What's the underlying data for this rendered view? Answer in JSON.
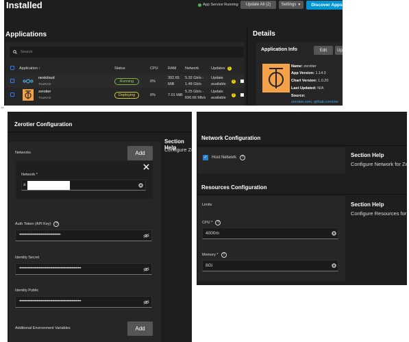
{
  "installed": {
    "title": "Installed",
    "status_text": "App Service Running",
    "update_all_label": "Update All (2)",
    "settings_label": "Settings",
    "discover_label": "Discover Apps",
    "applications_heading": "Applications",
    "details_heading": "Details",
    "search_placeholder": "Search",
    "columns": [
      "Application",
      "Status",
      "CPU",
      "RAM",
      "Network",
      "Updates"
    ],
    "rows": [
      {
        "name": "nextcloud",
        "source": "TrueNAS",
        "status": "Running",
        "cpu": "0%",
        "ram_a": "392.65",
        "ram_b": "MiB",
        "net_a": "5.32 Gb/s -",
        "net_b": "1.48 Gb/s",
        "upd_a": "Update",
        "upd_b": "available"
      },
      {
        "name": "zerotier",
        "source": "TrueNAS",
        "status": "Deploying",
        "cpu": "0%",
        "ram_a": "7.01 MiB",
        "ram_b": "",
        "net_a": "5.25 Gb/s -",
        "net_b": "696.66 Mb/s",
        "upd_a": "Update",
        "upd_b": "available"
      }
    ],
    "info": {
      "title": "Application Info",
      "edit_label": "Edit",
      "upd_label": "Up",
      "name_label": "Name:",
      "name": "zerotier",
      "appver_label": "App Version:",
      "appver": "1.14.0",
      "chartver_label": "Chart Version:",
      "chartver": "1.0.20",
      "lastupd_label": "Last Updated:",
      "lastupd": "N/A",
      "source_label": "Source:",
      "source_link": "zerotier.com, github.com/zer"
    }
  },
  "zerotier_config": {
    "title": "Zerotier Configuration",
    "networks_label": "Networks",
    "add_label": "Add",
    "network_label": "Network *",
    "network_value": "a",
    "auth_token_label": "Auth Token (API Key)",
    "auth_token_dots": "••••••••••••••••••••••••••••••••••••••••",
    "identity_secret_label": "Identity Secret",
    "identity_secret_dots": "••••••••••••••••••••••••••••••••••••••••••••••••••••••••••••",
    "identity_public_label": "Identity Public",
    "identity_public_dots": "••••••••••••••••••••••••••••••••••••••••••••••••••••••••••••",
    "env_label": "Additional Environment Variables",
    "env_add_label": "Add",
    "help_heading": "Section Help",
    "help_text": "Configure Zerotier"
  },
  "network_config": {
    "title": "Network Configuration",
    "host_network_label": "Host Network",
    "help_heading": "Section Help",
    "help_text": "Configure Network for Zerotier",
    "resources_title": "Resources Configuration",
    "limits_label": "Limits",
    "res_help_heading": "Section Help",
    "res_help_text": "Configure Resources for Zerotier",
    "cpu_label": "CPU *",
    "cpu_value": "4000m",
    "memory_label": "Memory *",
    "memory_value": "8Gi"
  },
  "colors": {
    "accent_blue": "#0095d5",
    "running_green": "#7cb342",
    "deploying_yellow": "#d4cc33",
    "panel_bg": "#1e1e1e",
    "zerotier_orange": "#f4a24a"
  }
}
